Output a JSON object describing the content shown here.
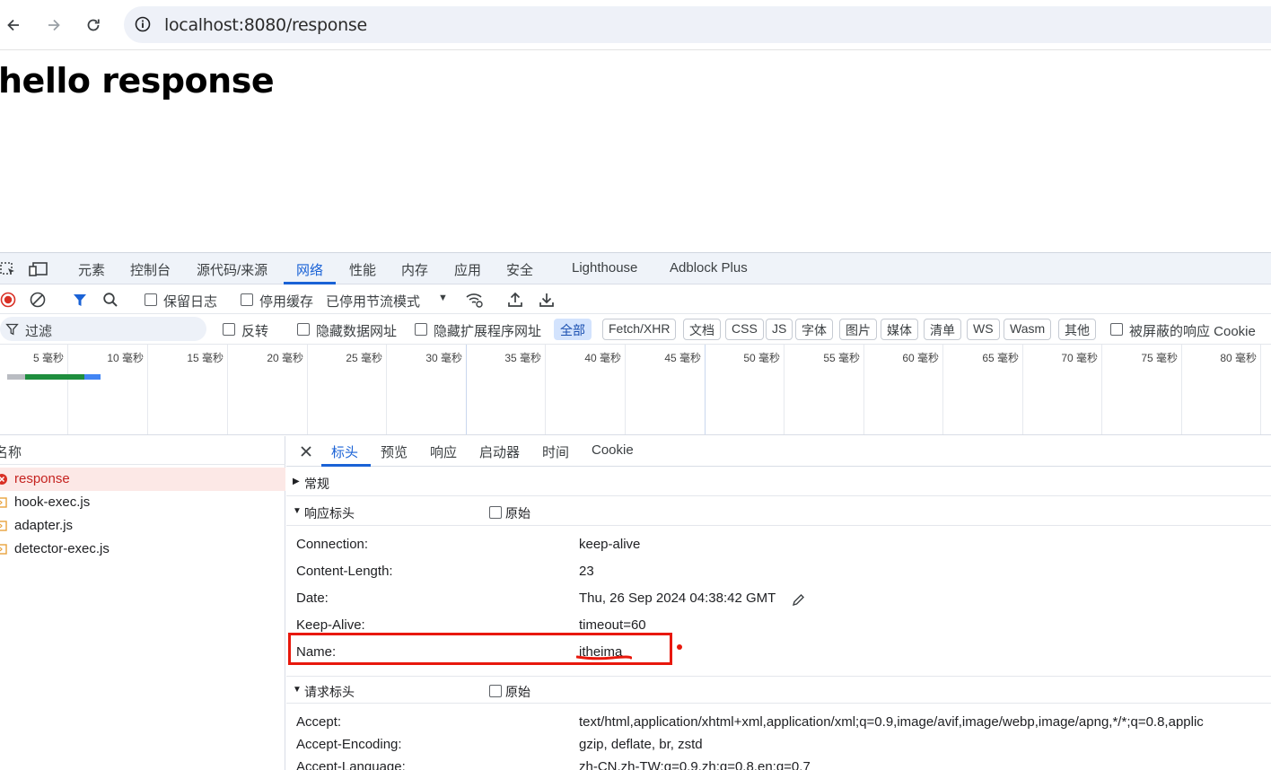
{
  "browser": {
    "url": "localhost:8080/response"
  },
  "page": {
    "heading": "hello response"
  },
  "devtools": {
    "tabs": [
      "元素",
      "控制台",
      "源代码/来源",
      "网络",
      "性能",
      "内存",
      "应用",
      "安全",
      "Lighthouse",
      "Adblock Plus"
    ],
    "active_tab": "网络",
    "toolbar": {
      "preserve_log": "保留日志",
      "disable_cache": "停用缓存",
      "throttling": "已停用节流模式"
    },
    "filter": {
      "placeholder": "过滤",
      "invert": "反转",
      "hide_data_urls": "隐藏数据网址",
      "hide_extension_urls": "隐藏扩展程序网址",
      "types": [
        "全部",
        "Fetch/XHR",
        "文档",
        "CSS",
        "JS",
        "字体",
        "图片",
        "媒体",
        "清单",
        "WS",
        "Wasm",
        "其他"
      ],
      "active_type": "全部",
      "blocked_cookies": "被屏蔽的响应 Cookie"
    },
    "timeline_ticks": [
      "5 毫秒",
      "10 毫秒",
      "15 毫秒",
      "20 毫秒",
      "25 毫秒",
      "30 毫秒",
      "35 毫秒",
      "40 毫秒",
      "45 毫秒",
      "50 毫秒",
      "55 毫秒",
      "60 毫秒",
      "65 毫秒",
      "70 毫秒",
      "75 毫秒",
      "80 毫秒"
    ],
    "requests": {
      "column": "名称",
      "items": [
        {
          "name": "response",
          "status": "error"
        },
        {
          "name": "hook-exec.js",
          "status": "ok"
        },
        {
          "name": "adapter.js",
          "status": "ok"
        },
        {
          "name": "detector-exec.js",
          "status": "ok"
        }
      ]
    },
    "detail_tabs": [
      "标头",
      "预览",
      "响应",
      "启动器",
      "时间",
      "Cookie"
    ],
    "active_detail_tab": "标头",
    "sections": {
      "general": "常规",
      "response_headers": "响应标头",
      "request_headers": "请求标头",
      "raw": "原始"
    },
    "response_headers": [
      {
        "key": "Connection:",
        "value": "keep-alive"
      },
      {
        "key": "Content-Length:",
        "value": "23"
      },
      {
        "key": "Date:",
        "value": "Thu, 26 Sep 2024 04:38:42 GMT"
      },
      {
        "key": "Keep-Alive:",
        "value": "timeout=60"
      },
      {
        "key": "Name:",
        "value": "itheima"
      }
    ],
    "request_headers": [
      {
        "key": "Accept:",
        "value": "text/html,application/xhtml+xml,application/xml;q=0.9,image/avif,image/webp,image/apng,*/*;q=0.8,applic"
      },
      {
        "key": "Accept-Encoding:",
        "value": "gzip, deflate, br, zstd"
      },
      {
        "key": "Accept-Language:",
        "value": "zh-CN,zh-TW;q=0.9,zh;q=0.8,en;q=0.7"
      }
    ]
  },
  "colors": {
    "accent": "#1a62d6",
    "annotation": "#e8180c",
    "error": "#c5221f"
  }
}
